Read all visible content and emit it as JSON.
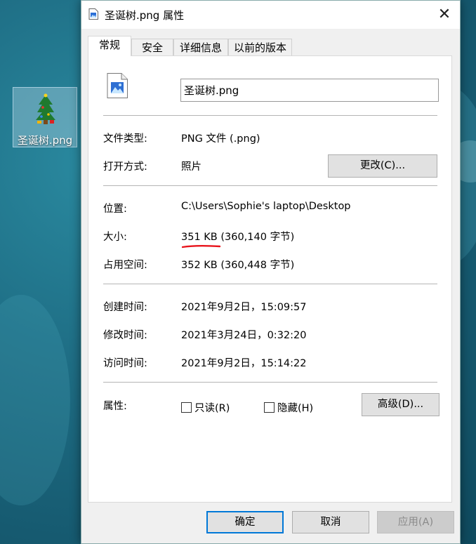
{
  "desktop": {
    "icon_label": "圣诞树.png"
  },
  "window": {
    "title": "圣诞树.png 属性",
    "close_glyph": "✕"
  },
  "tabs": [
    {
      "label": "常规",
      "active": true
    },
    {
      "label": "安全",
      "active": false
    },
    {
      "label": "详细信息",
      "active": false
    },
    {
      "label": "以前的版本",
      "active": false
    }
  ],
  "general": {
    "file_name": "圣诞树.png",
    "file_type_label": "文件类型:",
    "file_type_value": "PNG 文件 (.png)",
    "opens_with_label": "打开方式:",
    "opens_with_value": "照片",
    "change_button": "更改(C)...",
    "location_label": "位置:",
    "location_value": "C:\\Users\\Sophie's laptop\\Desktop",
    "size_label": "大小:",
    "size_value": "351 KB (360,140 字节)",
    "size_on_disk_label": "占用空间:",
    "size_on_disk_value": "352 KB (360,448 字节)",
    "created_label": "创建时间:",
    "created_value": "2021年9月2日，15:09:57",
    "modified_label": "修改时间:",
    "modified_value": "2021年3月24日，0:32:20",
    "accessed_label": "访问时间:",
    "accessed_value": "2021年9月2日，15:14:22",
    "attributes_label": "属性:",
    "readonly_label": "只读(R)",
    "readonly_checked": false,
    "hidden_label": "隐藏(H)",
    "hidden_checked": false,
    "advanced_button": "高级(D)..."
  },
  "footer": {
    "ok_button": "确定",
    "cancel_button": "取消",
    "apply_button": "应用(A)"
  },
  "colors": {
    "annotation_red": "#e8141c",
    "focus_blue": "#0078d7"
  },
  "icons": {
    "title": "image-file-icon",
    "file": "image-file-icon",
    "desktop": "christmas-tree-image-icon"
  }
}
